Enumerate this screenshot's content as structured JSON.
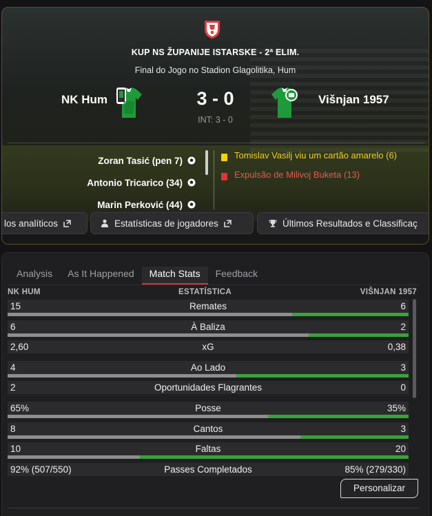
{
  "header": {
    "competition": "KUP NS ŽUPANIJE ISTARSKE - 2ª ELIM.",
    "venue": "Final do Jogo no Stadion Glagolitika, Hum",
    "home_team": "NK Hum",
    "away_team": "Višnjan 1957",
    "score": "3 - 0",
    "halftime": "INT: 3 - 0",
    "scorers": [
      "Zoran Tasić (pen 7)",
      "Antonio Tricarico (34)",
      "Marin Perković (44)"
    ],
    "events": [
      {
        "type": "yellow",
        "text": "Tomislav Vasilj viu um cartão amarelo (6)"
      },
      {
        "type": "red",
        "text": "Expulsão de Milivoj Buketa (13)"
      }
    ],
    "buttons": [
      "los analíticos",
      "Estatísticas de jogadores",
      "Últimos Resultados e Classificaç"
    ],
    "colors": {
      "accent_border": "#5a5028",
      "home_kit": "#1f9a3a",
      "away_kit": "#1f9a3a"
    }
  },
  "tabs": [
    "Analysis",
    "As It Happened",
    "Match Stats",
    "Feedback"
  ],
  "active_tab": "Match Stats",
  "stats": {
    "home_header": "NK HUM",
    "mid_header": "ESTATÍSTICA",
    "away_header": "VIŠNJAN 1957",
    "rows": [
      {
        "label": "Remates",
        "home": "15",
        "away": "6",
        "home_share": 0.71
      },
      {
        "label": "À Baliza",
        "home": "6",
        "away": "2",
        "home_share": 0.75
      },
      {
        "label": "xG",
        "home": "2,60",
        "away": "0,38",
        "home_share": null
      },
      {
        "label": "Ao Lado",
        "home": "4",
        "away": "3",
        "home_share": 0.57
      },
      {
        "label": "Oportunidades Flagrantes",
        "home": "2",
        "away": "0",
        "home_share": null
      },
      {
        "label": "Posse",
        "home": "65%",
        "away": "35%",
        "home_share": 0.65
      },
      {
        "label": "Cantos",
        "home": "8",
        "away": "3",
        "home_share": 0.73
      },
      {
        "label": "Faltas",
        "home": "10",
        "away": "20",
        "home_share": 0.33
      },
      {
        "label": "Passes Completados",
        "home": "92% (507/550)",
        "away": "85% (279/330)",
        "home_share": null
      }
    ],
    "personalize_label": "Personalizar",
    "colors": {
      "home_bar": "#8e8e8e",
      "away_bar": "#3aa23a"
    }
  }
}
